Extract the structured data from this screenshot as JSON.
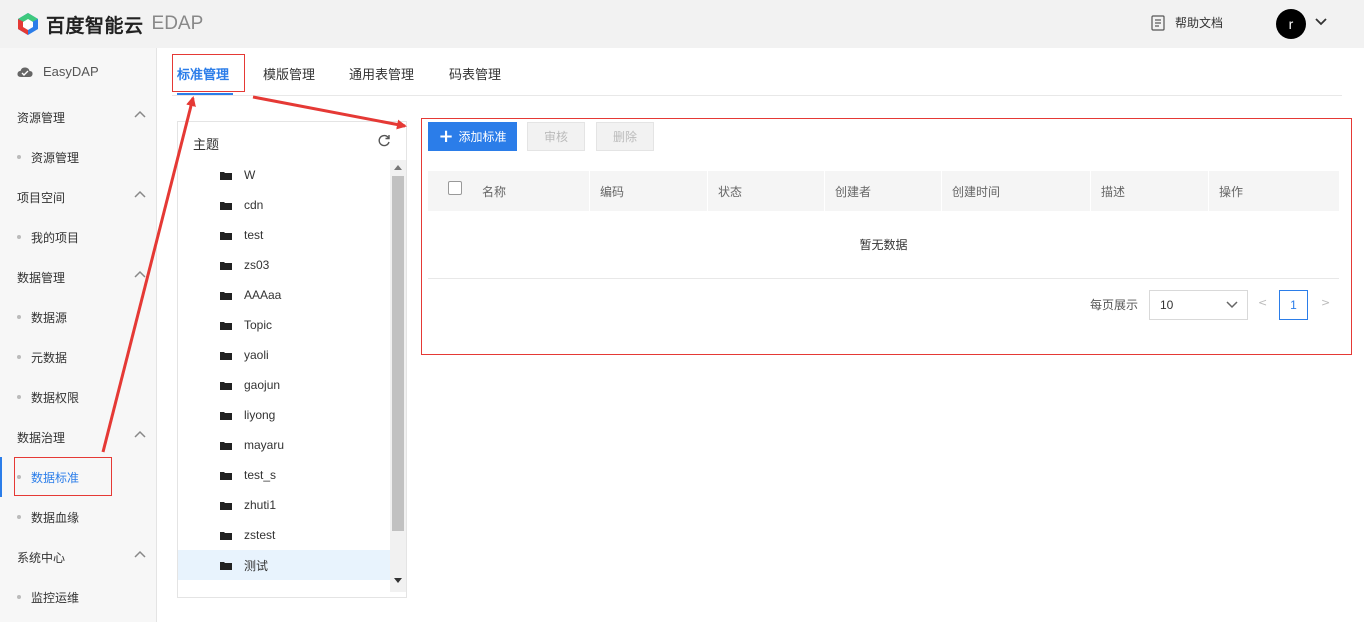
{
  "header": {
    "logo_text": "百度智能云",
    "product": "EDAP",
    "help_label": "帮助文档",
    "avatar_letter": "r"
  },
  "sidebar": {
    "brand": "EasyDAP",
    "groups": [
      {
        "label": "资源管理",
        "items": [
          "资源管理"
        ]
      },
      {
        "label": "项目空间",
        "items": [
          "我的项目"
        ]
      },
      {
        "label": "数据管理",
        "items": [
          "数据源",
          "元数据",
          "数据权限"
        ]
      },
      {
        "label": "数据治理",
        "items": [
          "数据标准",
          "数据血缘"
        ]
      },
      {
        "label": "系统中心",
        "items": [
          "监控运维"
        ]
      }
    ],
    "active_item": "数据标准"
  },
  "tabs": [
    "标准管理",
    "模版管理",
    "通用表管理",
    "码表管理"
  ],
  "tree": {
    "title": "主题",
    "items": [
      "W",
      "cdn",
      "test",
      "zs03",
      "AAAaa",
      "Topic",
      "yaoli",
      "gaojun",
      "liyong",
      "mayaru",
      "test_s",
      "zhuti1",
      "zstest",
      "测试"
    ],
    "selected": "测试"
  },
  "toolbar": {
    "add_label": "添加标准",
    "review_label": "审核",
    "delete_label": "删除"
  },
  "table": {
    "columns": [
      "名称",
      "编码",
      "状态",
      "创建者",
      "创建时间",
      "描述",
      "操作"
    ],
    "empty_text": "暂无数据"
  },
  "pager": {
    "per_page_label": "每页展示",
    "page_size": "10",
    "prev": "<",
    "current_page": "1",
    "next": ">"
  },
  "colors": {
    "accent": "#2b7de9",
    "annotation": "#e53935"
  }
}
